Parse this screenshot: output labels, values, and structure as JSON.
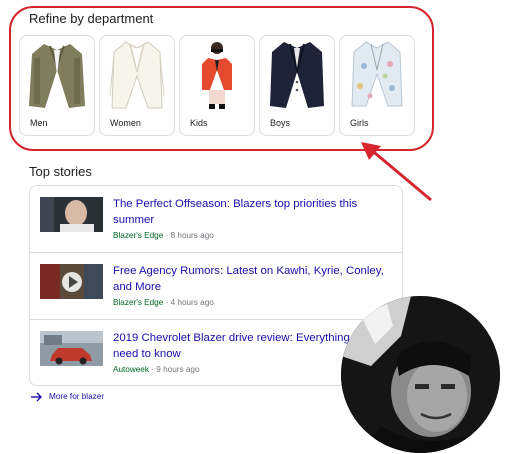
{
  "department": {
    "title": "Refine by department",
    "items": [
      {
        "label": "Men"
      },
      {
        "label": "Women"
      },
      {
        "label": "Kids"
      },
      {
        "label": "Boys"
      },
      {
        "label": "Girls"
      }
    ]
  },
  "stories": {
    "title": "Top stories",
    "items": [
      {
        "headline": "The Perfect Offseason: Blazers top priorities this summer",
        "source": "Blazer's Edge",
        "separator": "·",
        "age": "8 hours ago"
      },
      {
        "headline": "Free Agency Rumors: Latest on Kawhi, Kyrie, Conley, and More",
        "source": "Blazer's Edge",
        "separator": "·",
        "age": "4 hours ago"
      },
      {
        "headline": "2019 Chevrolet Blazer drive review: Everything you need to know",
        "source": "Autoweek",
        "separator": "·",
        "age": "9 hours ago"
      }
    ]
  },
  "more_link": "More for blazer",
  "colors": {
    "highlight": "#d6252f",
    "link": "#1a0dab",
    "source": "#006621",
    "muted": "#70757a",
    "border": "#dadce0"
  }
}
